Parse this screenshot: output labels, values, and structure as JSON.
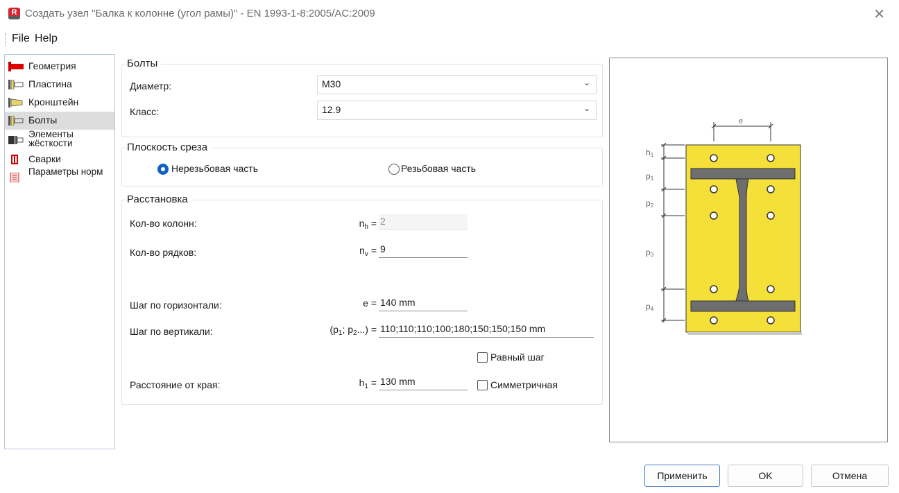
{
  "window": {
    "title": "Создать узел \"Балка к колонне (угол рамы)\" - EN 1993-1-8:2005/AC:2009",
    "icon_text": "R",
    "close_icon": "close-icon"
  },
  "menu": {
    "file": "File",
    "help": "Help"
  },
  "nav": {
    "items": [
      {
        "label": "Геометрия",
        "icon": "geometry-icon"
      },
      {
        "label": "Пластина",
        "icon": "plate-icon"
      },
      {
        "label": "Кронштейн",
        "icon": "bracket-icon"
      },
      {
        "label": "Болты",
        "icon": "bolts-icon",
        "selected": true
      },
      {
        "label": "Элементы жёсткости",
        "icon": "stiffeners-icon"
      },
      {
        "label": "Сварки",
        "icon": "welds-icon"
      },
      {
        "label": "Параметры норм",
        "icon": "code-params-icon"
      }
    ]
  },
  "bolts": {
    "title": "Болты",
    "diameter_label": "Диаметр:",
    "diameter_value": "M30",
    "class_label": "Класс:",
    "class_value": "12.9"
  },
  "shear_plane": {
    "title": "Плоскость среза",
    "option1": "Нерезьбовая часть",
    "option2": "Резьбовая часть",
    "selected": "option1"
  },
  "layout": {
    "title": "Расстановка",
    "columns_label": "Кол-во колонн:",
    "columns_symbol": "n",
    "columns_sub": "h",
    "columns_value": "2",
    "rows_label": "Кол-во рядков:",
    "rows_symbol": "n",
    "rows_sub": "v",
    "rows_value": "9",
    "hstep_label": "Шаг по горизонтали:",
    "hstep_symbol": "e =",
    "hstep_value": "140 mm",
    "vstep_label": "Шаг по вертикали:",
    "vstep_symbol_a": "(p",
    "vstep_sub1": "1",
    "vstep_symbol_b": "; p",
    "vstep_sub2": "2",
    "vstep_symbol_c": "...) =",
    "vstep_value": "110;110;110;100;180;150;150;150 mm",
    "equal_step_label": "Равный шаг",
    "edge_label": "Расстояние от края:",
    "edge_symbol": "h",
    "edge_sub": "1",
    "edge_value": "130 mm",
    "symmetric_label": "Симметричная",
    "equals": "="
  },
  "diagram": {
    "labels": {
      "e": "e",
      "h1": "h",
      "h1_sub": "1",
      "p1": "p",
      "p1_sub": "1",
      "p2": "p",
      "p2_sub": "2",
      "p3": "p",
      "p3_sub": "3",
      "p4": "p",
      "p4_sub": "4"
    },
    "plate_color": "#f5e03a",
    "beam_color": "#6e6e6e"
  },
  "buttons": {
    "apply": "Применить",
    "ok": "OK",
    "cancel": "Отмена"
  }
}
